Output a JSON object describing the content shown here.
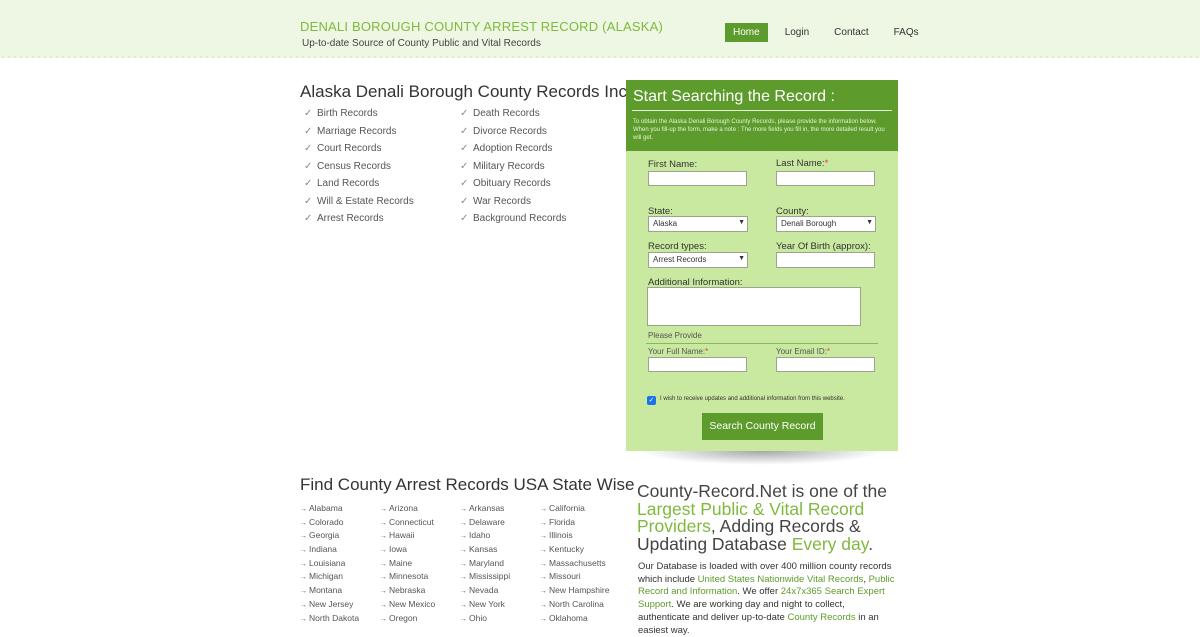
{
  "header": {
    "title_main": "DENALI BOROUGH COUNTY ARREST RECORD",
    "title_suffix": "(ALASKA)",
    "subtitle": "Up-to-date Source of  County Public and Vital Records",
    "nav": [
      "Home",
      "Login",
      "Contact",
      "FAQs"
    ]
  },
  "records": {
    "heading": "Alaska Denali Borough County Records Include",
    "left": [
      "Birth Records",
      "Marriage Records",
      "Court Records",
      "Census Records",
      "Land Records",
      "Will & Estate Records",
      "Arrest Records"
    ],
    "right": [
      "Death Records",
      "Divorce Records",
      "Adoption Records",
      "Military Records",
      "Obituary Records",
      "War Records",
      "Background Records"
    ]
  },
  "form": {
    "title": "Start Searching the Record :",
    "desc": "To obtain the Alaska Denali Borough County Records, please provide the information below. When you fill-up the form, make a note : The more fields you fill in, the more detailed result you will get.",
    "first_name": "First Name:",
    "last_name": "Last Name:",
    "required_mark": "*",
    "state": "State:",
    "state_value": "Alaska",
    "county": "County:",
    "county_value": "Denali Borough",
    "record_types": "Record types:",
    "record_value": "Arrest Records",
    "yob": "Year Of Birth (approx):",
    "additional": "Additional Information:",
    "please_provide": "Please Provide",
    "full_name": "Your Full Name:",
    "email": "Your Email ID:",
    "checkbox_label": "I wish to receive updates and additional information from this website.",
    "submit": "Search County Record"
  },
  "states": {
    "heading": "Find County Arrest Records USA State Wise",
    "cols": [
      [
        "Alabama",
        "Colorado",
        "Georgia",
        "Indiana",
        "Louisiana",
        "Michigan",
        "Montana",
        "New Jersey",
        "North Dakota"
      ],
      [
        "Arizona",
        "Connecticut",
        "Hawaii",
        "Iowa",
        "Maine",
        "Minnesota",
        "Nebraska",
        "New Mexico",
        "Oregon"
      ],
      [
        "Arkansas",
        "Delaware",
        "Idaho",
        "Kansas",
        "Maryland",
        "Mississippi",
        "Nevada",
        "New York",
        "Ohio"
      ],
      [
        "California",
        "Florida",
        "Illinois",
        "Kentucky",
        "Massachusetts",
        "Missouri",
        "New Hampshire",
        "North Carolina",
        "Oklahoma"
      ]
    ]
  },
  "promo": {
    "h1": "County-Record.Net is one of the ",
    "h2": "Largest Public & Vital Record Providers",
    "h3": ", Adding Records & Updating Database ",
    "h4": "Every day",
    "h5": ".",
    "p1": "Our Database is loaded with over 400 million county records which include ",
    "l1": "United States Nationwide Vital Records",
    "p2": ", ",
    "l2": "Public Record and Information",
    "p3": ". We offer ",
    "l3": "24x7x365 Search Expert Support",
    "p4": ". We are working day and night to collect, authenticate and deliver up-to-date ",
    "l4": "County Records",
    "p5": " in an easiest way."
  },
  "colors": {
    "brand_green": "#5d9c2c",
    "light_green": "#c9e8a0",
    "title_green": "#7fb93e",
    "header_bg": "#eef6e4"
  }
}
